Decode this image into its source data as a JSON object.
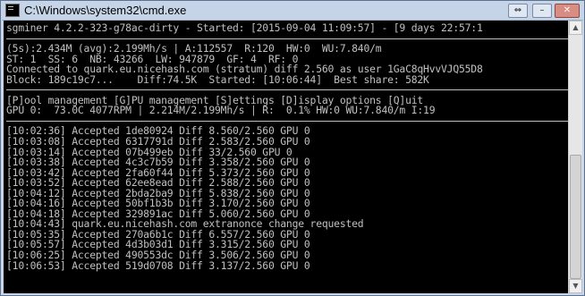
{
  "window": {
    "title": "C:\\Windows\\system32\\cmd.exe",
    "controls": {
      "resize": "⇔",
      "minimize": "–",
      "close": "✕"
    }
  },
  "console": {
    "header": "sgminer 4.2.2-323-g78ac-dirty - Started: [2015-09-04 11:09:57] - [9 days 22:57:1",
    "stats": [
      "(5s):2.434M (avg):2.199Mh/s | A:112557  R:120  HW:0  WU:7.840/m",
      "ST: 1  SS: 6  NB: 43266  LW: 947879  GF: 4  RF: 0",
      "Connected to quark.eu.nicehash.com (stratum) diff 2.560 as user 1GaC8qHvvVJQ55D8",
      "Block: 189c19c7...    Diff:74.5K  Started: [10:06:44]  Best share: 582K"
    ],
    "menu": "[P]ool management [G]PU management [S]ettings [D]isplay options [Q]uit",
    "gpu": "GPU 0:  73.0C 4077RPM | 2.214M/2.199Mh/s | R:  0.1% HW:0 WU:7.840/m I:19",
    "log": [
      "[10:02:36] Accepted 1de80924 Diff 8.560/2.560 GPU 0",
      "[10:03:08] Accepted 6317791d Diff 2.583/2.560 GPU 0",
      "[10:03:14] Accepted 07b499eb Diff 33/2.560 GPU 0",
      "[10:03:38] Accepted 4c3c7b59 Diff 3.358/2.560 GPU 0",
      "[10:03:42] Accepted 2fa60f44 Diff 5.373/2.560 GPU 0",
      "[10:03:52] Accepted 62ee8ead Diff 2.588/2.560 GPU 0",
      "[10:04:12] Accepted 2bda2ba9 Diff 5.838/2.560 GPU 0",
      "[10:04:16] Accepted 50bf1b3b Diff 3.170/2.560 GPU 0",
      "[10:04:18] Accepted 329891ac Diff 5.060/2.560 GPU 0",
      "[10:04:43] quark.eu.nicehash.com extranonce change requested",
      "[10:05:35] Accepted 270a6b1c Diff 6.557/2.560 GPU 0",
      "[10:05:57] Accepted 4d3b03d1 Diff 3.315/2.560 GPU 0",
      "[10:06:25] Accepted 490553dc Diff 3.506/2.560 GPU 0",
      "[10:06:53] Accepted 519d0708 Diff 3.137/2.560 GPU 0"
    ]
  },
  "scrollbar": {
    "up_glyph": "▲",
    "down_glyph": "▼"
  },
  "colors": {
    "console_bg": "#000000",
    "console_text": "#c0c0c0",
    "titlebar": "#c6d4e8"
  }
}
